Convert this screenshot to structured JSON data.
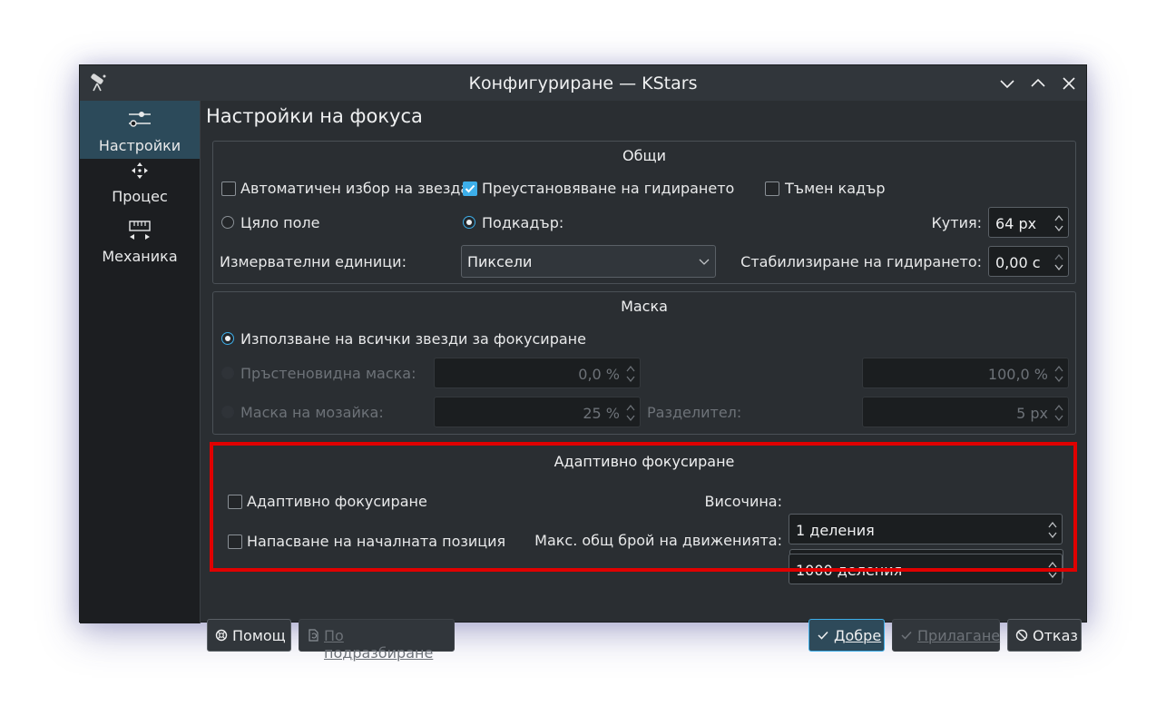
{
  "window": {
    "title": "Конфигуриране — KStars"
  },
  "sidebar": {
    "items": [
      {
        "label": "Настройки",
        "icon": "sliders-icon",
        "active": true
      },
      {
        "label": "Процес",
        "icon": "move-arrows-icon",
        "active": false
      },
      {
        "label": "Механика",
        "icon": "ruler-icon",
        "active": false
      }
    ]
  },
  "page": {
    "title": "Настройки на фокуса"
  },
  "general": {
    "title": "Общи",
    "auto_select_star": "Автоматичен избор на звезда",
    "suspend_guiding": "Преустановяване на гидирането",
    "dark_frame": "Тъмен кадър",
    "full_field": "Цяло поле",
    "subframe": "Подкадър:",
    "box_label": "Кутия:",
    "box_value": "64 px",
    "units_label": "Измервателни единици:",
    "units_value": "Пиксели",
    "guide_settle_label": "Стабилизиране на гидирането:",
    "guide_settle_value": "0,00 с"
  },
  "mask": {
    "title": "Маска",
    "use_all_stars": "Използване на всички звезди за фокусиране",
    "ring_mask": "Пръстеновидна маска:",
    "ring_inner": "0,0 %",
    "ring_outer": "100,0 %",
    "mosaic_mask": "Маска на мозайка:",
    "mosaic_value": "25 %",
    "separator_label": "Разделител:",
    "separator_value": "5 px"
  },
  "adaptive": {
    "title": "Адаптивно фокусиране",
    "adaptive_focus": "Адаптивно фокусиране",
    "adaptive_start": "Напасване на началната позиция",
    "altitude_label": "Височина:",
    "altitude_value": "1 деления",
    "max_moves_label": "Макс. общ брой на движенията:",
    "max_moves_value": "1000 деления"
  },
  "buttons": {
    "help": "Помощ",
    "defaults": "По подразбиране",
    "ok": "Добре",
    "apply": "Прилагане",
    "cancel": "Отказ"
  },
  "colors": {
    "accent": "#3daee9",
    "highlight_border": "#e00000",
    "window_bg": "#2a2e32"
  }
}
